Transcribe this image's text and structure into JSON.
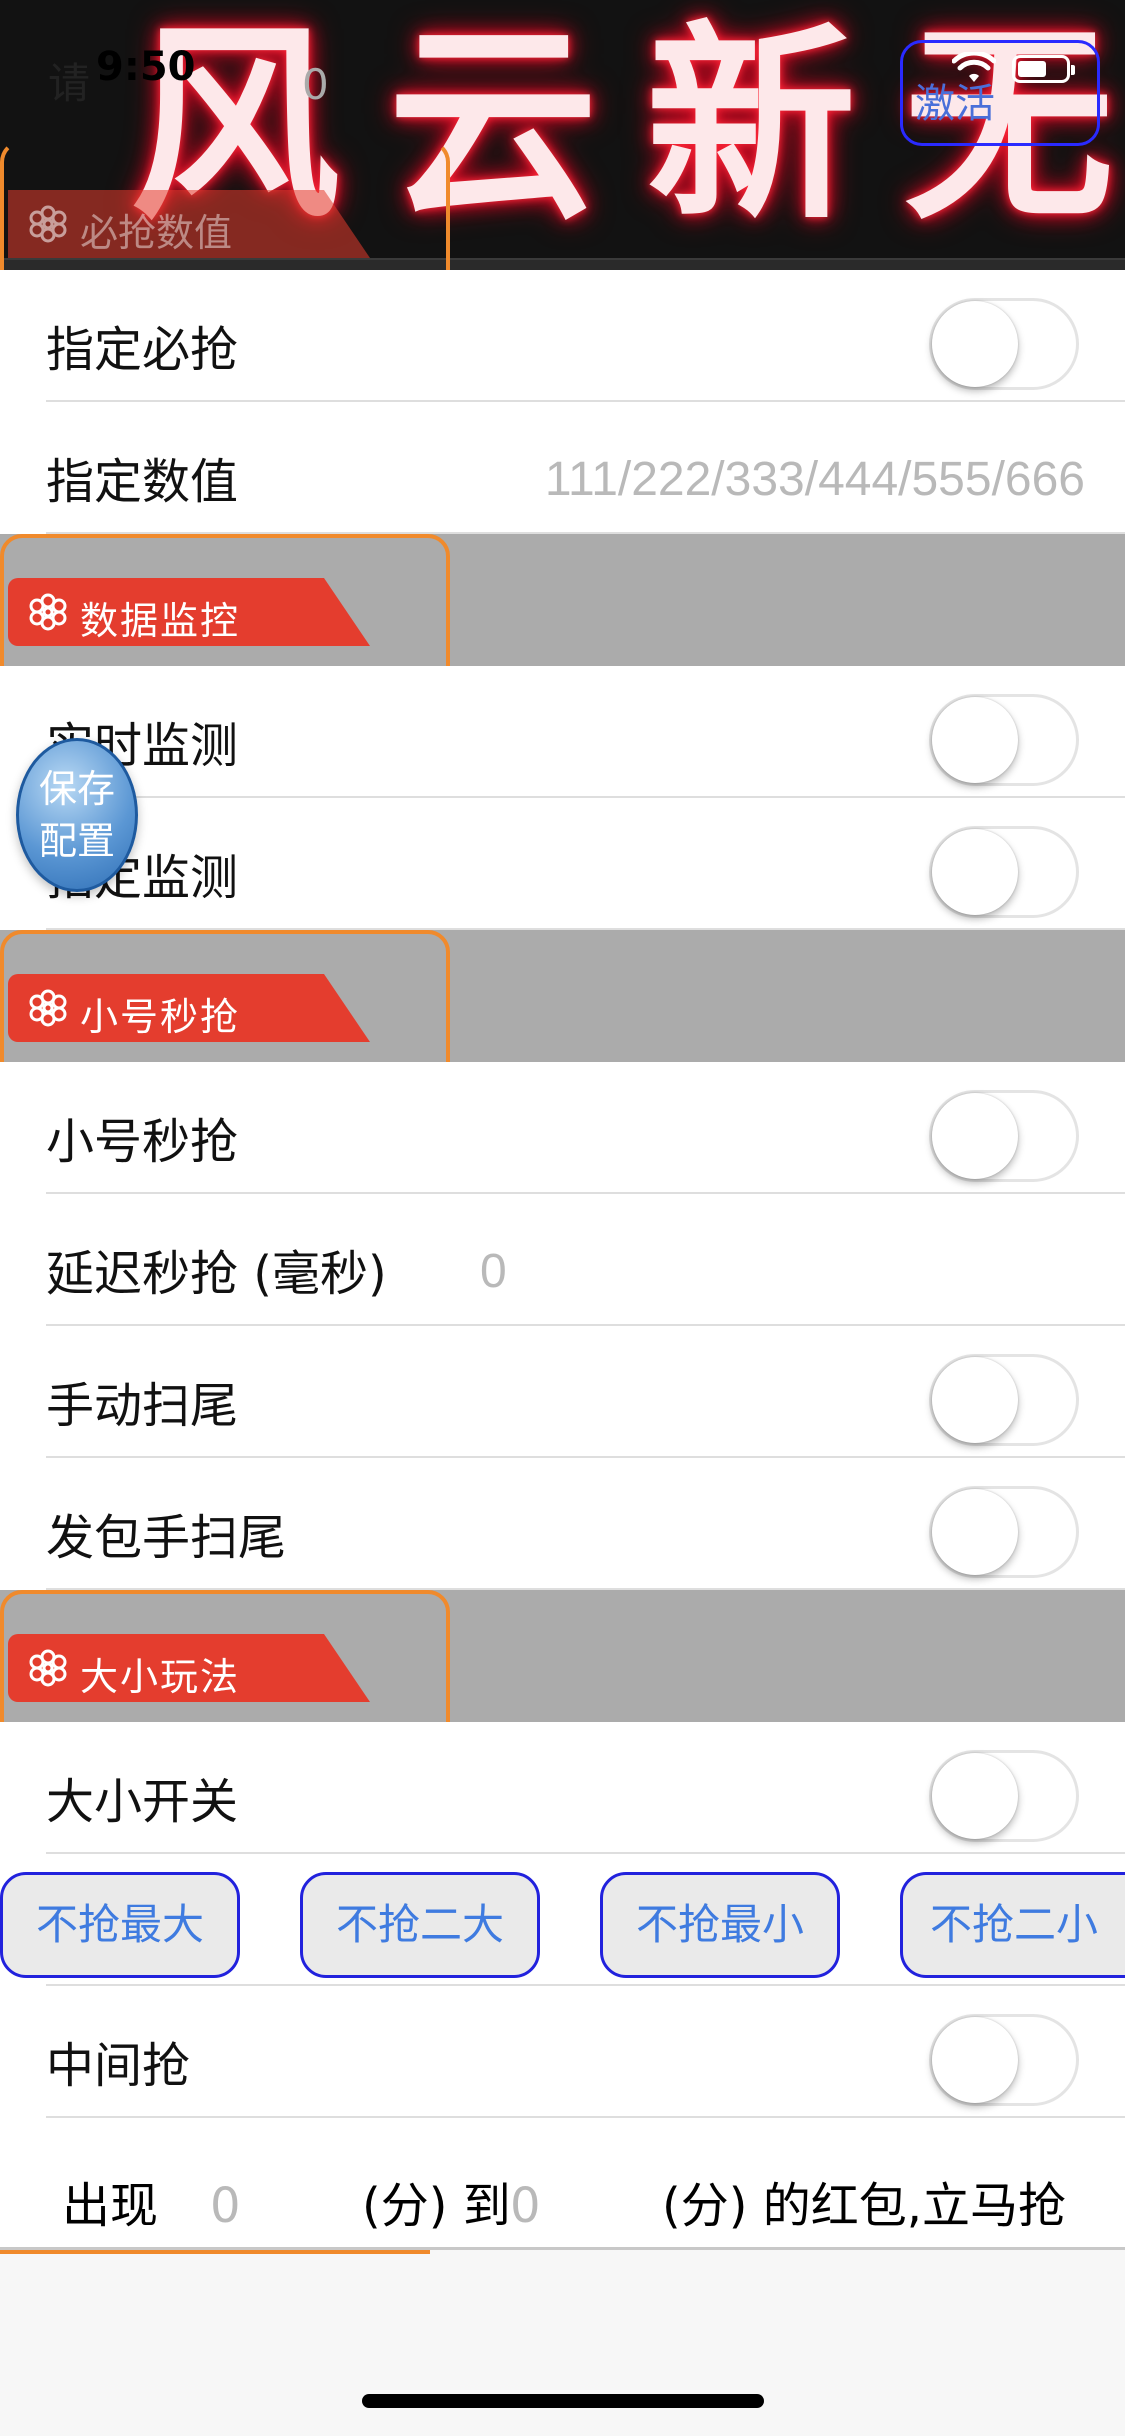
{
  "banner": {
    "title": "风云新无",
    "status_left": "请",
    "status_time": "9:50",
    "status_zero": "0",
    "activate_label": "激活"
  },
  "sections": {
    "must_grab": "必抢数值",
    "data_monitor": "数据监控",
    "alt_grab": "小号秒抢",
    "size_play": "大小玩法"
  },
  "rows": {
    "specify_must_grab": "指定必抢",
    "specify_value": "指定数值",
    "specify_value_placeholder": "111/222/333/444/555/666",
    "realtime_monitor": "实时监测",
    "specify_monitor": "指定监测",
    "alt_grab": "小号秒抢",
    "delay_grab": "延迟秒抢 (毫秒)",
    "delay_value": "0",
    "manual_tail": "手动扫尾",
    "sender_tail": "发包手扫尾",
    "size_switch": "大小开关",
    "middle_grab": "中间抢"
  },
  "toggles": {
    "specify_must_grab": false,
    "realtime_monitor": false,
    "specify_monitor": false,
    "alt_grab": false,
    "manual_tail": false,
    "sender_tail": false,
    "size_switch": false,
    "middle_grab": false
  },
  "chips": [
    "不抢最大",
    "不抢二大",
    "不抢最小",
    "不抢二小"
  ],
  "appear": {
    "prefix": "出现",
    "from_value": "0",
    "mid": "(分) 到",
    "to_value": "0",
    "suffix": "(分) 的红包,立马抢"
  },
  "float_button": {
    "line1": "保存",
    "line2": "配置"
  },
  "colors": {
    "section_tag": "#e43d2e",
    "frame": "#f08a2c",
    "section_bg": "#ababab",
    "chip_text": "#3f7be0"
  }
}
